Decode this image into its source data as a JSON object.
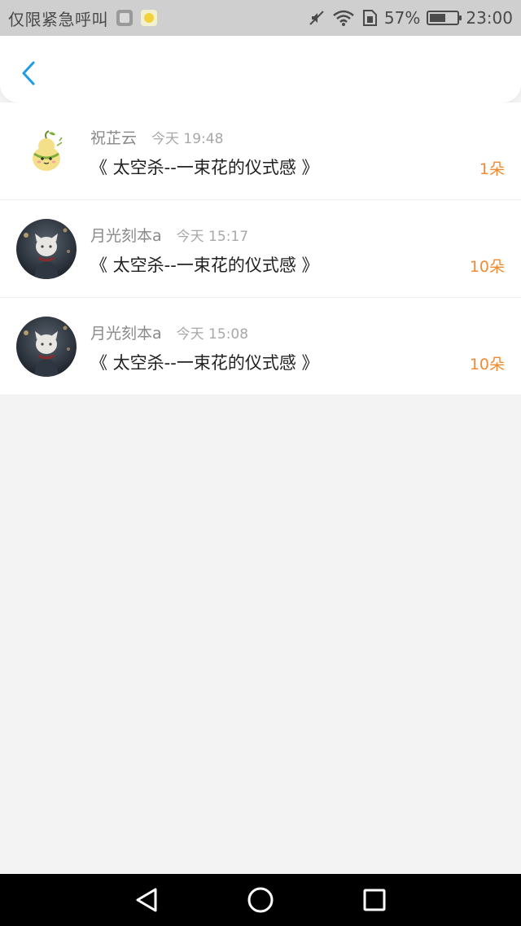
{
  "status_bar": {
    "carrier": "仅限紧急呼叫",
    "battery_percent": "57%",
    "battery_level": 0.57,
    "time": "23:00",
    "icons": [
      "gallery-notification-icon",
      "app-notification-icon",
      "mute-icon",
      "wifi-icon",
      "sim-icon",
      "battery-icon"
    ]
  },
  "header": {
    "back_icon": "chevron-left-icon",
    "accent_color": "#1e9be6"
  },
  "list": {
    "items": [
      {
        "name": "祝芷云",
        "time": "今天 19:48",
        "title": "《 太空杀--一束花的仪式感 》",
        "count": "1朵",
        "avatar": "gourd-sticker-avatar"
      },
      {
        "name": "月光刻本a",
        "time": "今天 15:17",
        "title": "《 太空杀--一束花的仪式感 》",
        "count": "10朵",
        "avatar": "anime-cat-avatar"
      },
      {
        "name": "月光刻本a",
        "time": "今天 15:08",
        "title": "《 太空杀--一束花的仪式感 》",
        "count": "10朵",
        "avatar": "anime-cat-avatar"
      }
    ],
    "count_color": "#f08a33"
  },
  "nav_bar": {
    "buttons": [
      "back-triangle-icon",
      "home-circle-icon",
      "recents-square-icon"
    ]
  }
}
